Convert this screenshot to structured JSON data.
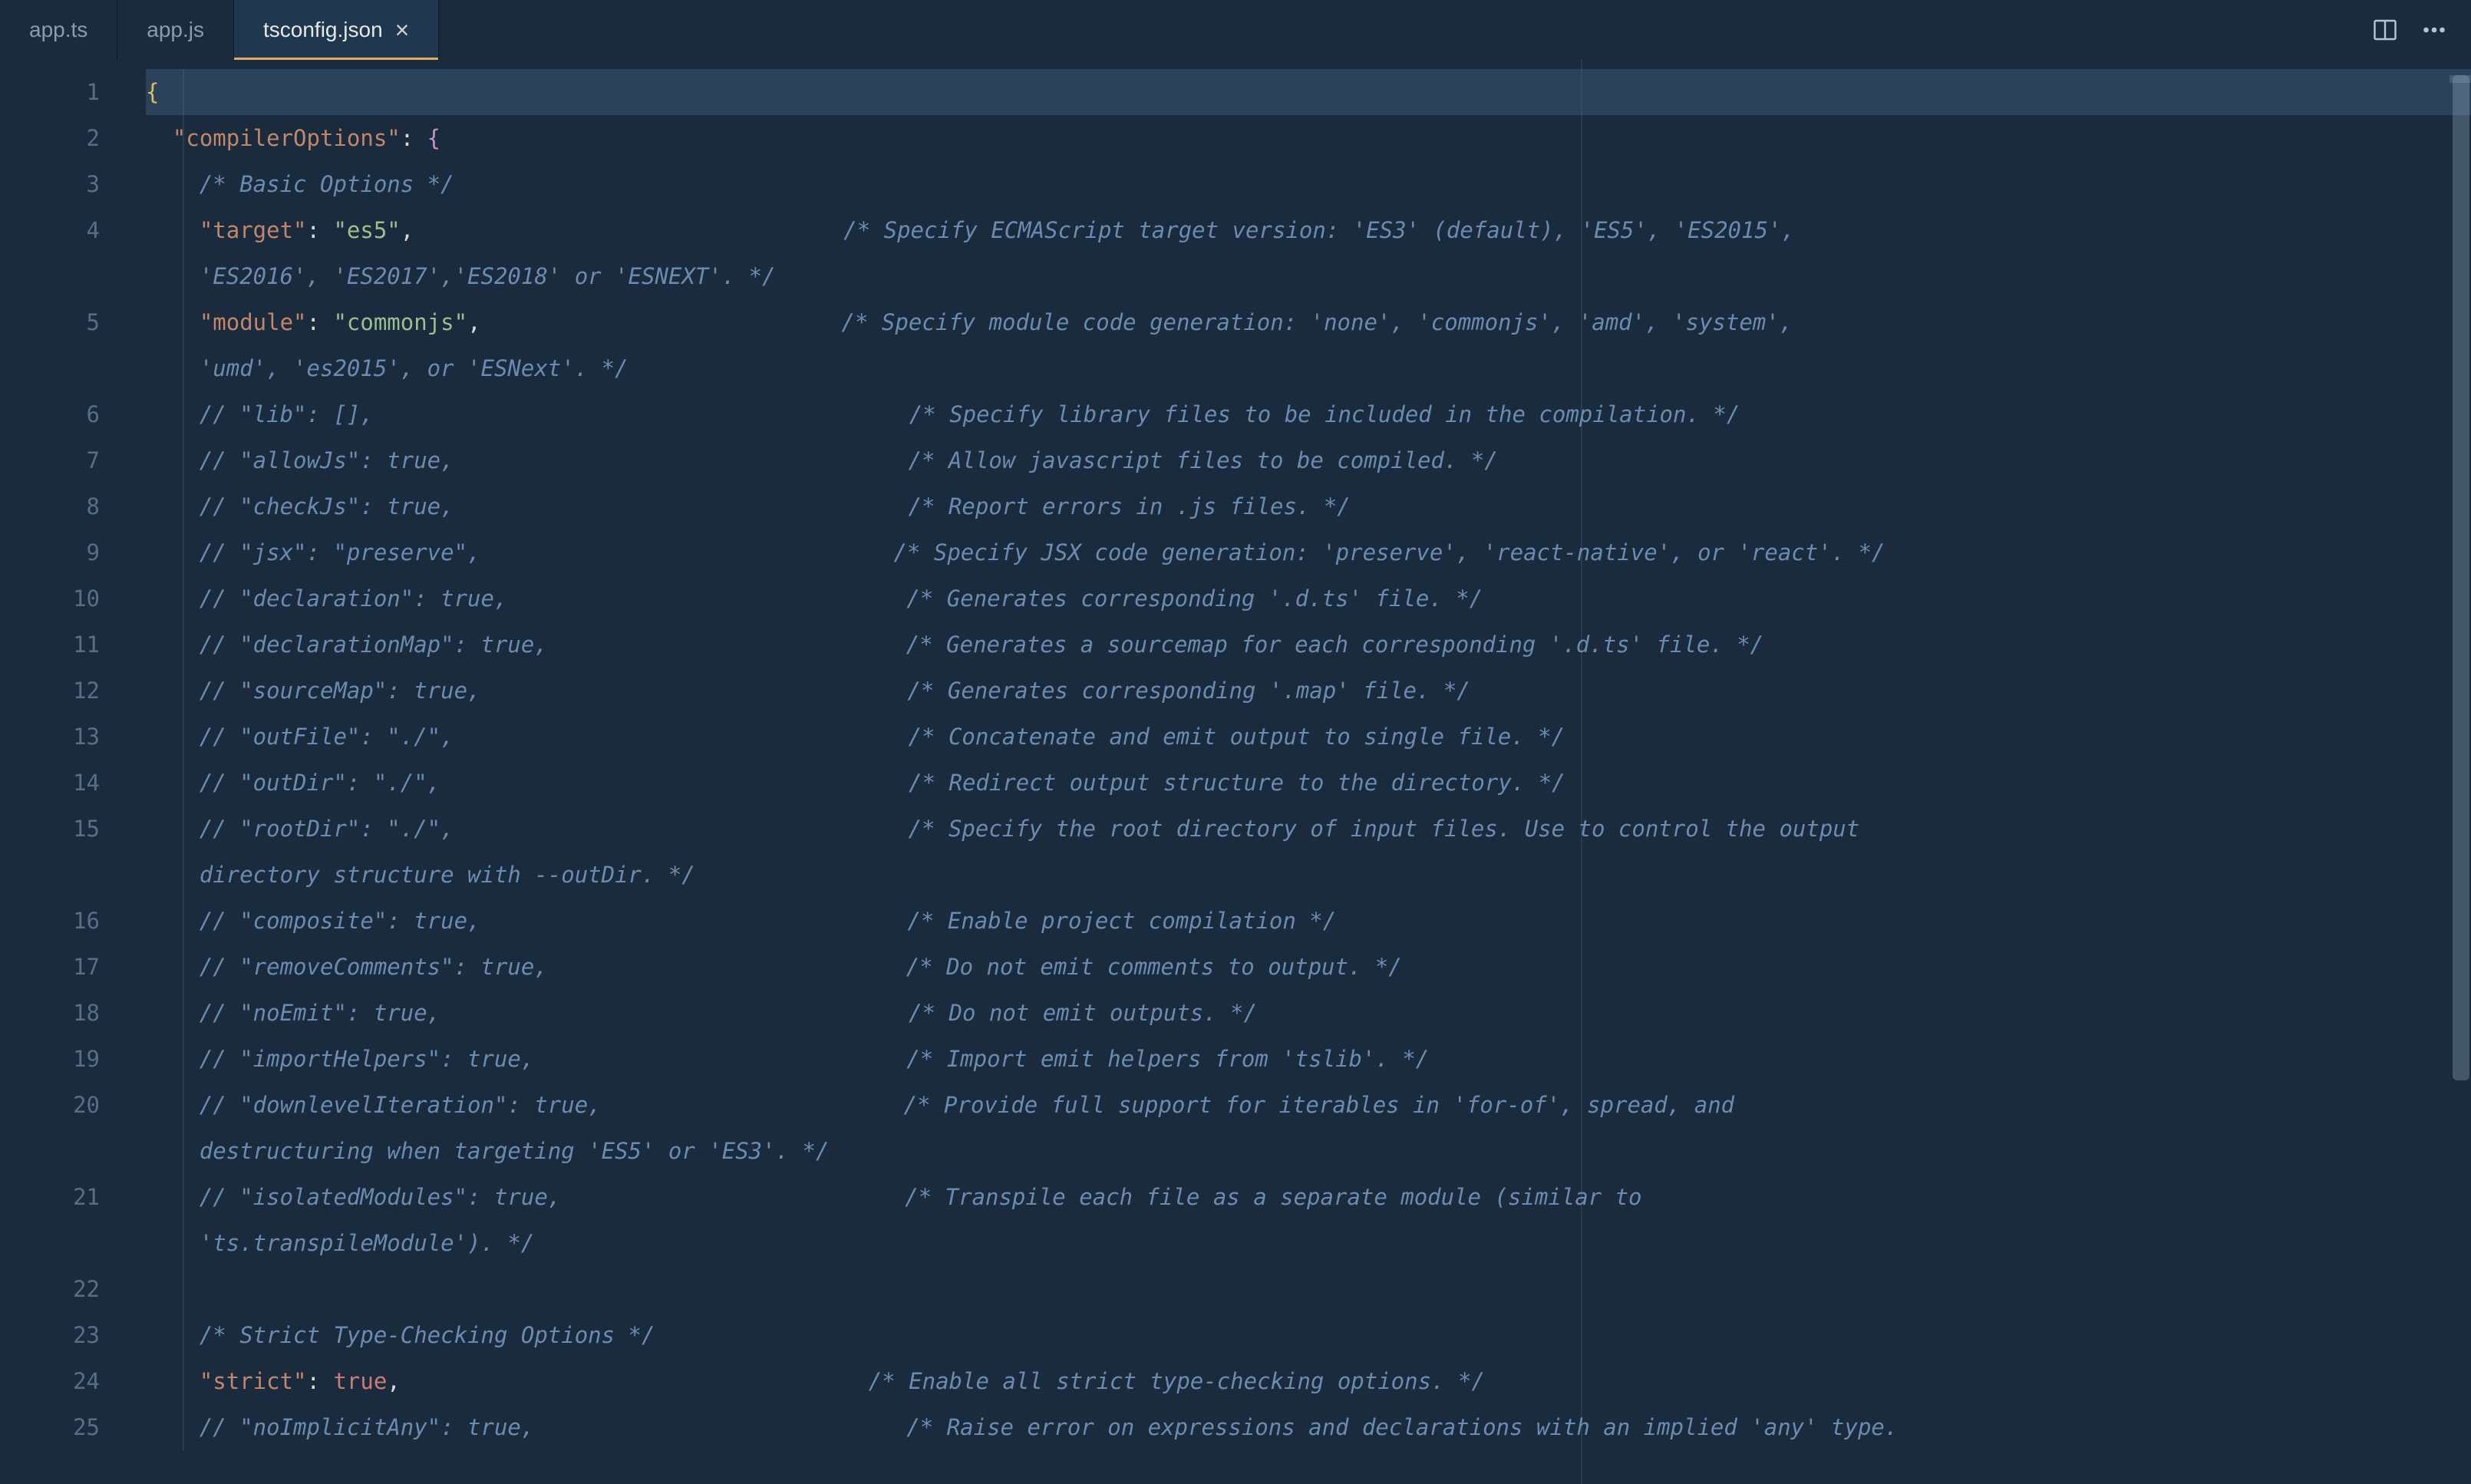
{
  "tabs": {
    "t0": {
      "label": "app.ts"
    },
    "t1": {
      "label": "app.js"
    },
    "t2": {
      "label": "tsconfig.json",
      "close": "×"
    }
  },
  "code": {
    "l1_brace": "{",
    "l2_key": "\"compilerOptions\"",
    "l2_colon": ": ",
    "l2_brace": "{",
    "l3_comment": "/* Basic Options */",
    "l4_key": "\"target\"",
    "l4_colon": ": ",
    "l4_val": "\"es5\"",
    "l4_comma": ",",
    "l4_comment": "/* Specify ECMAScript target version: 'ES3' (default), 'ES5', 'ES2015', ",
    "l4w_comment": "'ES2016', 'ES2017','ES2018' or 'ESNEXT'. */",
    "l5_key": "\"module\"",
    "l5_colon": ": ",
    "l5_val": "\"commonjs\"",
    "l5_comma": ",",
    "l5_comment": "/* Specify module code generation: 'none', 'commonjs', 'amd', 'system', ",
    "l5w_comment": "'umd', 'es2015', or 'ESNext'. */",
    "l6_a": "// \"lib\": [],",
    "l6_b": "/* Specify library files to be included in the compilation. */",
    "l7_a": "// \"allowJs\": true,",
    "l7_b": "/* Allow javascript files to be compiled. */",
    "l8_a": "// \"checkJs\": true,",
    "l8_b": "/* Report errors in .js files. */",
    "l9_a": "// \"jsx\": \"preserve\",",
    "l9_b": "/* Specify JSX code generation: 'preserve', 'react-native', or 'react'. */",
    "l10_a": "// \"declaration\": true,",
    "l10_b": "/* Generates corresponding '.d.ts' file. */",
    "l11_a": "// \"declarationMap\": true,",
    "l11_b": "/* Generates a sourcemap for each corresponding '.d.ts' file. */",
    "l12_a": "// \"sourceMap\": true,",
    "l12_b": "/* Generates corresponding '.map' file. */",
    "l13_a": "// \"outFile\": \"./\",",
    "l13_b": "/* Concatenate and emit output to single file. */",
    "l14_a": "// \"outDir\": \"./\",",
    "l14_b": "/* Redirect output structure to the directory. */",
    "l15_a": "// \"rootDir\": \"./\",",
    "l15_b": "/* Specify the root directory of input files. Use to control the output ",
    "l15w": "directory structure with --outDir. */",
    "l16_a": "// \"composite\": true,",
    "l16_b": "/* Enable project compilation */",
    "l17_a": "// \"removeComments\": true,",
    "l17_b": "/* Do not emit comments to output. */",
    "l18_a": "// \"noEmit\": true,",
    "l18_b": "/* Do not emit outputs. */",
    "l19_a": "// \"importHelpers\": true,",
    "l19_b": "/* Import emit helpers from 'tslib'. */",
    "l20_a": "// \"downlevelIteration\": true,",
    "l20_b": "/* Provide full support for iterables in 'for-of', spread, and ",
    "l20w": "destructuring when targeting 'ES5' or 'ES3'. */",
    "l21_a": "// \"isolatedModules\": true,",
    "l21_b": "/* Transpile each file as a separate module (similar to ",
    "l21w": "'ts.transpileModule'). */",
    "l22": "",
    "l23": "/* Strict Type-Checking Options */",
    "l24_key": "\"strict\"",
    "l24_colon": ": ",
    "l24_val": "true",
    "l24_comma": ",",
    "l24_comment": "/* Enable all strict type-checking options. */",
    "l25_a": "// \"noImplicitAny\": true,",
    "l25_b": "/* Raise error on expressions and declarations with an implied 'any' type. "
  },
  "lineNumbers": [
    "1",
    "2",
    "3",
    "4",
    "",
    "5",
    "",
    "6",
    "7",
    "8",
    "9",
    "10",
    "11",
    "12",
    "13",
    "14",
    "15",
    "",
    "16",
    "17",
    "18",
    "19",
    "20",
    "",
    "21",
    "",
    "22",
    "23",
    "24",
    "25"
  ]
}
